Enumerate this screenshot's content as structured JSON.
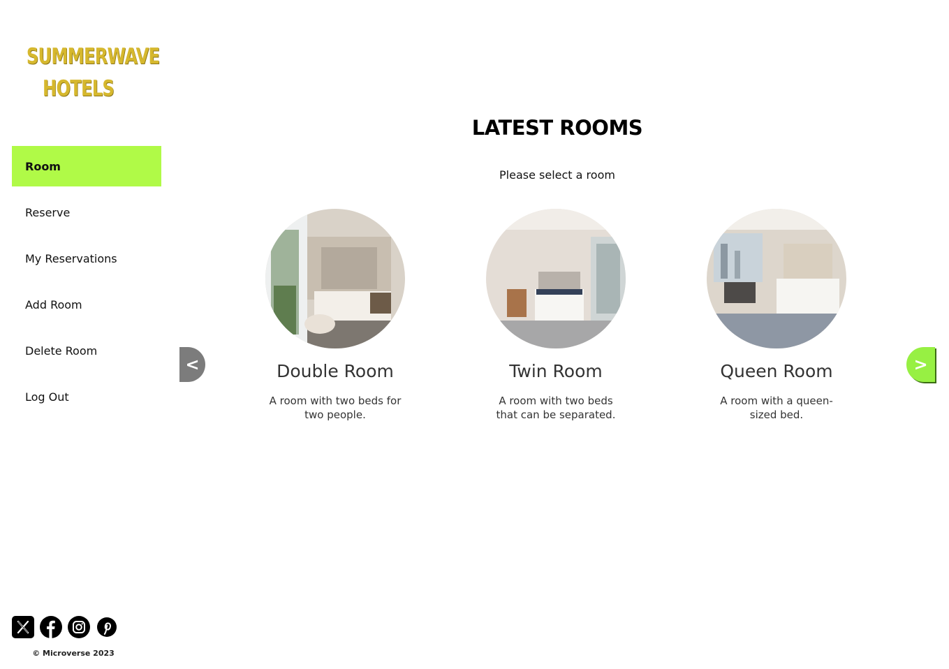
{
  "brand": {
    "line1": "SUMMERWAVE",
    "line2": "HOTELS"
  },
  "nav": {
    "items": [
      {
        "label": "Room"
      },
      {
        "label": "Reserve"
      },
      {
        "label": "My Reservations"
      },
      {
        "label": "Add Room"
      },
      {
        "label": "Delete Room"
      },
      {
        "label": "Log Out"
      }
    ]
  },
  "main": {
    "title": "LATEST ROOMS",
    "subtitle": "Please select a room",
    "prev_label": "<",
    "next_label": ">",
    "rooms": [
      {
        "name": "Double Room",
        "description": "A room with two beds for two people."
      },
      {
        "name": "Twin Room",
        "description": "A room with two beds that can be separated."
      },
      {
        "name": "Queen Room",
        "description": "A room with a queen-sized bed."
      }
    ]
  },
  "footer": {
    "social": [
      "x-icon",
      "facebook-icon",
      "instagram-icon",
      "pinterest-icon"
    ],
    "copyright": "© Microverse 2023"
  },
  "colors": {
    "accent": "#b0fa47",
    "brand_gold": "#d6b82e",
    "arrow_gray": "#7c7c7c"
  }
}
